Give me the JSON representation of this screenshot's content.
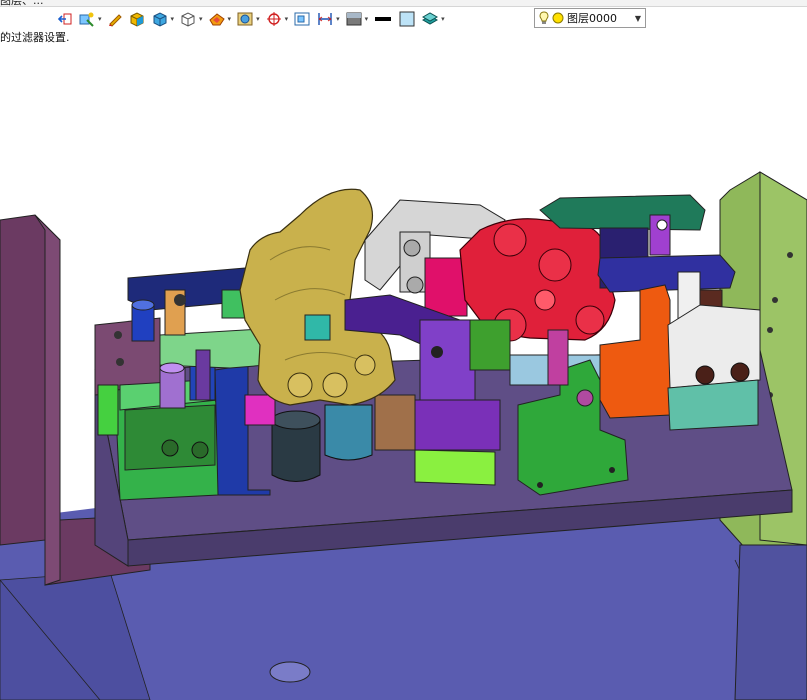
{
  "window": {
    "title_fragment": "图层、..."
  },
  "toolbar": {
    "buttons": [
      {
        "name": "exit-sketch-icon",
        "has_dropdown": false
      },
      {
        "name": "selection-filter-icon",
        "has_dropdown": true
      },
      {
        "name": "pencil-icon",
        "has_dropdown": false
      },
      {
        "name": "shaded-box-icon",
        "has_dropdown": false
      },
      {
        "name": "solid-cube-icon",
        "has_dropdown": true
      },
      {
        "name": "wireframe-cube-icon",
        "has_dropdown": true
      },
      {
        "name": "orient-view-icon",
        "has_dropdown": true
      },
      {
        "name": "render-style-icon",
        "has_dropdown": true
      },
      {
        "name": "snap-point-icon",
        "has_dropdown": true
      },
      {
        "name": "fit-view-icon",
        "has_dropdown": false
      },
      {
        "name": "dimension-icon",
        "has_dropdown": true
      },
      {
        "name": "background-icon",
        "has_dropdown": true
      },
      {
        "name": "line-color-icon",
        "has_dropdown": false
      },
      {
        "name": "fill-color-icon",
        "has_dropdown": false
      },
      {
        "name": "layer-settings-icon",
        "has_dropdown": true
      }
    ],
    "layer_select": {
      "value": "图层0000",
      "icons": [
        "bulb-icon",
        "yellow-circle-icon"
      ]
    }
  },
  "status": {
    "filter_note": "的过滤器设置."
  },
  "colors": {
    "floor": "#5a5cb0",
    "base_plate": "#5f4e86",
    "left_panel": "#6b3a62",
    "right_panel": "#8fb85a",
    "gold_part": "#c9b14c",
    "red_part": "#e0203a",
    "green_part": "#3e8f2a"
  }
}
